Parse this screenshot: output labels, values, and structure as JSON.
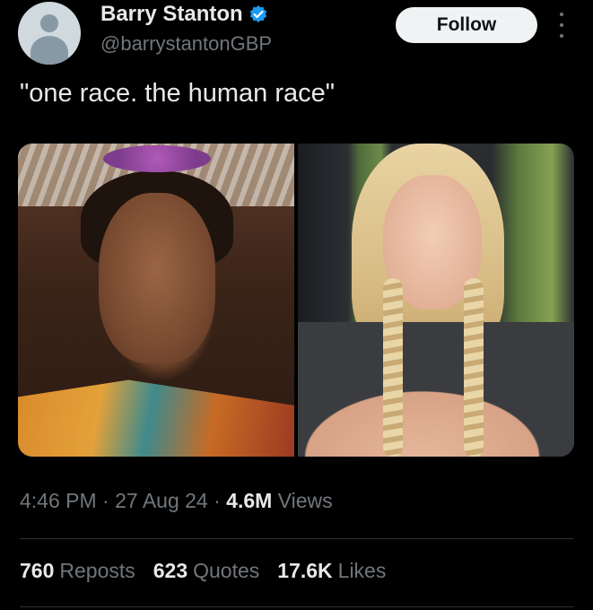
{
  "author": {
    "display_name": "Barry Stanton",
    "handle": "@barrystantonGBP",
    "verified": true,
    "verified_color": "#1d9bf0"
  },
  "follow_label": "Follow",
  "tweet_text": "\"one race. the human race\"",
  "meta": {
    "time": "4:46 PM",
    "sep1": "·",
    "date": "27 Aug 24",
    "sep2": "·",
    "views_count": "4.6M",
    "views_label": "Views"
  },
  "stats": [
    {
      "count": "760",
      "label": "Reposts"
    },
    {
      "count": "623",
      "label": "Quotes"
    },
    {
      "count": "17.6K",
      "label": "Likes"
    }
  ],
  "media": [
    {
      "icon": "photo-left"
    },
    {
      "icon": "photo-right"
    }
  ]
}
